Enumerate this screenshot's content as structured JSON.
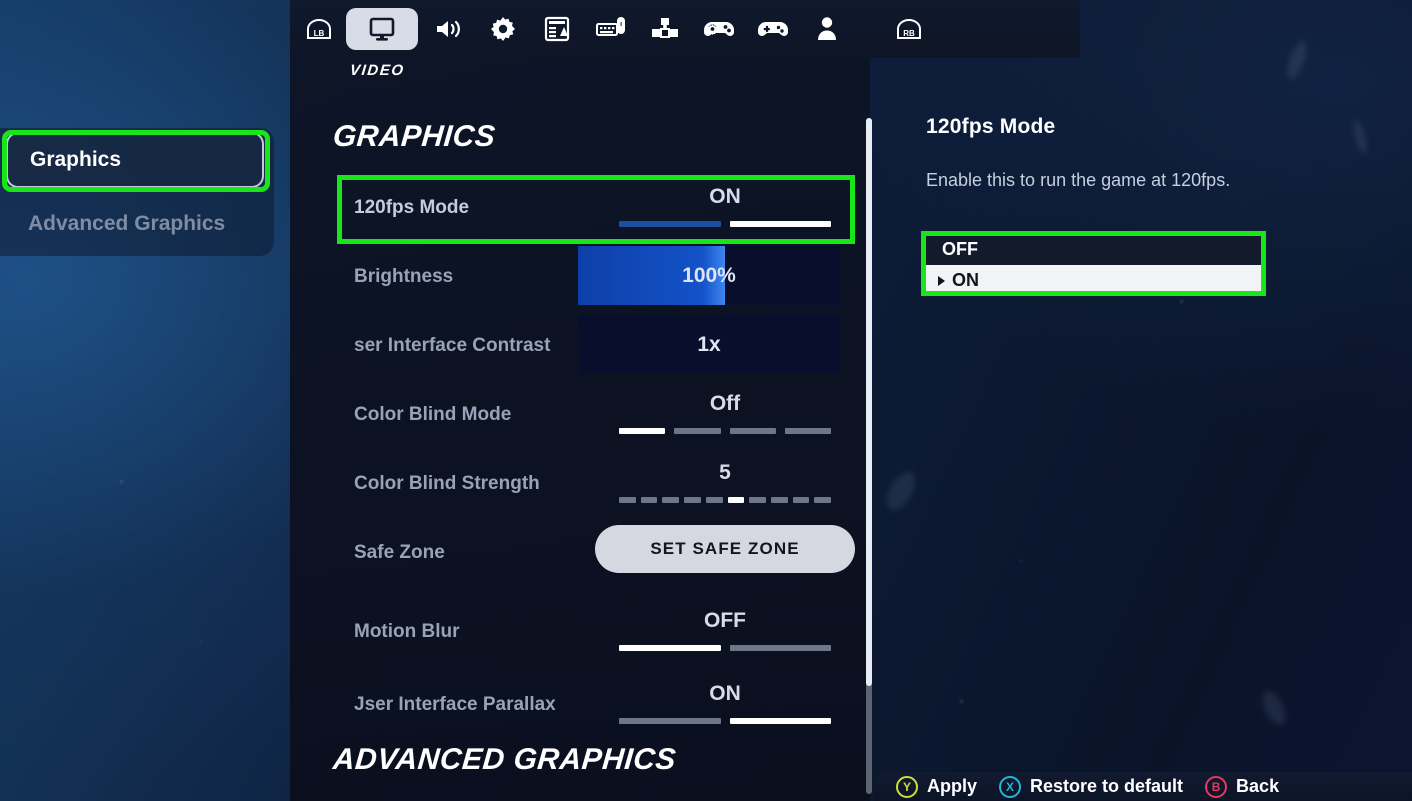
{
  "nav": {
    "left_shoulder": "LB",
    "right_shoulder": "RB",
    "active_label": "VIDEO",
    "items": [
      {
        "icon": "shoulder-button-lb-icon",
        "name": "nav-shoulder-lb",
        "active": false
      },
      {
        "icon": "monitor-icon",
        "name": "nav-tab-video",
        "active": true
      },
      {
        "icon": "speaker-icon",
        "name": "nav-tab-audio",
        "active": false
      },
      {
        "icon": "gear-icon",
        "name": "nav-tab-game",
        "active": false
      },
      {
        "icon": "hud-layout-icon",
        "name": "nav-tab-hud",
        "active": false
      },
      {
        "icon": "keyboard-mouse-icon",
        "name": "nav-tab-input",
        "active": false
      },
      {
        "icon": "building-blocks-icon",
        "name": "nav-tab-build",
        "active": false
      },
      {
        "icon": "controller-gear-icon",
        "name": "nav-tab-controller-config",
        "active": false
      },
      {
        "icon": "controller-icon",
        "name": "nav-tab-controller",
        "active": false
      },
      {
        "icon": "person-icon",
        "name": "nav-tab-account",
        "active": false
      },
      {
        "icon": "shoulder-button-rb-icon",
        "name": "nav-shoulder-rb",
        "active": false
      }
    ]
  },
  "sidebar": {
    "items": [
      {
        "label": "Graphics",
        "selected": true
      },
      {
        "label": "Advanced Graphics",
        "selected": false
      }
    ]
  },
  "main": {
    "section_title": "GRAPHICS",
    "next_section_title": "ADVANCED GRAPHICS",
    "rows": [
      {
        "label": "120fps Mode",
        "type": "toggle",
        "value": "ON",
        "segments": [
          "blue",
          "on"
        ],
        "highlighted": true
      },
      {
        "label": "Brightness",
        "type": "slider",
        "value": "100%",
        "fill_percent": 56
      },
      {
        "label": "ser Interface Contrast",
        "type": "slider",
        "value": "1x",
        "fill_percent": 0
      },
      {
        "label": "Color Blind Mode",
        "type": "segments",
        "value": "Off",
        "segment_count": 4,
        "active_index": 0
      },
      {
        "label": "Color Blind Strength",
        "type": "segments",
        "value": "5",
        "segment_count": 10,
        "active_index": 5
      },
      {
        "label": "Safe Zone",
        "type": "button",
        "value": "SET SAFE ZONE"
      },
      {
        "label": "Motion Blur",
        "type": "toggle",
        "value": "OFF",
        "segments": [
          "on",
          "off"
        ]
      },
      {
        "label": "Jser Interface Parallax",
        "type": "toggle",
        "value": "ON",
        "segments": [
          "off",
          "on"
        ]
      }
    ]
  },
  "detail": {
    "title": "120fps Mode",
    "description": "Enable this to run the game at 120fps.",
    "options": [
      {
        "label": "OFF",
        "selected": false
      },
      {
        "label": "ON",
        "selected": true
      }
    ]
  },
  "action_bar": {
    "actions": [
      {
        "button": "Y",
        "label": "Apply",
        "color": "#c9e03a"
      },
      {
        "button": "X",
        "label": "Restore to default",
        "color": "#1fb6d8"
      },
      {
        "button": "B",
        "label": "Back",
        "color": "#e33a5e"
      }
    ]
  },
  "annotations": {
    "highlight_color": "#19e619",
    "boxes": [
      "sidebar-graphics",
      "row-120fps-mode",
      "detail-dropdown"
    ]
  }
}
